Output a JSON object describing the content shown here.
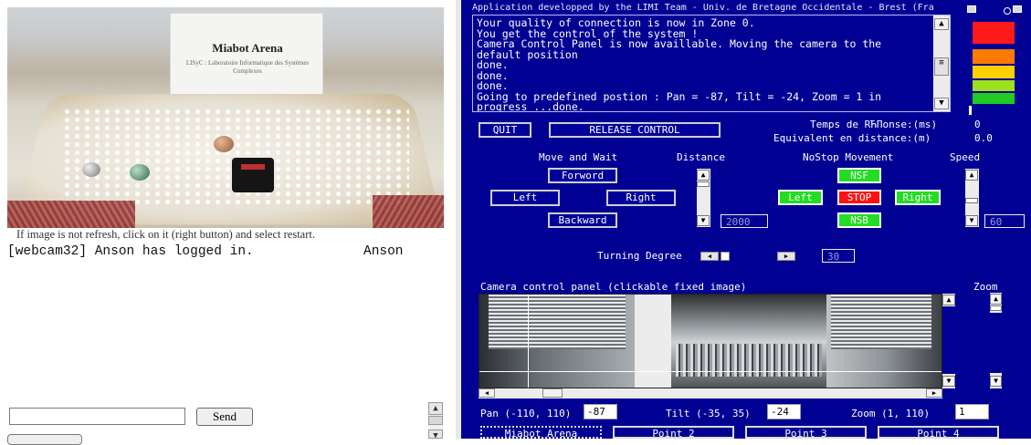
{
  "left": {
    "webcam": {
      "board_title": "Miabot Arena",
      "board_subtitle": "LISyC : Laboratoire Informatique des Systèmes Complexes"
    },
    "refresh_hint": "If image is not refresh, click on it (right button) and select restart.",
    "chat": {
      "line": "[webcam32] Anson has logged in.",
      "user": "Anson",
      "input_value": "",
      "send_label": "Send"
    }
  },
  "right": {
    "app_title": "Application developped by the LIMI Team - Univ. de Bretagne Occidentale - Brest (Fra",
    "log_text": "Your quality of connection is now in Zone 0.\nYou get the control of the system !\nCamera Control Panel is now availlable. Moving the camera to the default position\ndone.\ndone.\ndone.\nGoing to predefined postion : Pan = -87, Tilt = -24, Zoom = 1 in progress ...done.",
    "quit_label": "QUIT",
    "release_label": "RELEASE CONTROL",
    "response_time_label": "Temps de RЋПonse:(ms)",
    "response_time_value": "0",
    "distance_equiv_label": "Equivalent en distance:(m)",
    "distance_equiv_value": "0.0",
    "move_wait_label": "Move and Wait",
    "distance_label": "Distance",
    "nostop_label": "NoStop Movement",
    "speed_label": "Speed",
    "forward_label": "Forword",
    "backward_label": "Backward",
    "left_label": "Left",
    "right_label": "Right",
    "nsf_label": "NSF",
    "nsb_label": "NSB",
    "stop_label": "STOP",
    "ns_left_label": "Left",
    "ns_right_label": "Right",
    "distance_value": "2000",
    "speed_value": "60",
    "turning_label": "Turning Degree",
    "turning_value": "30",
    "camera_panel_label": "Camera control panel (clickable fixed image)",
    "zoom_label": "Zoom",
    "pan_label": "Pan (-110, 110)",
    "pan_value": "-87",
    "tilt_label": "Tilt (-35, 35)",
    "tilt_value": "-24",
    "zoom_range_label": "Zoom (1, 110)",
    "zoom_value": "1",
    "presets": [
      "Miabot Arena",
      "Point 2",
      "Point 3",
      "Point 4"
    ],
    "meter_colors": [
      "#ff1a1a",
      "#ff7a00",
      "#ffd000",
      "#9fe020",
      "#22cc22"
    ],
    "meter_level": 0.2
  }
}
